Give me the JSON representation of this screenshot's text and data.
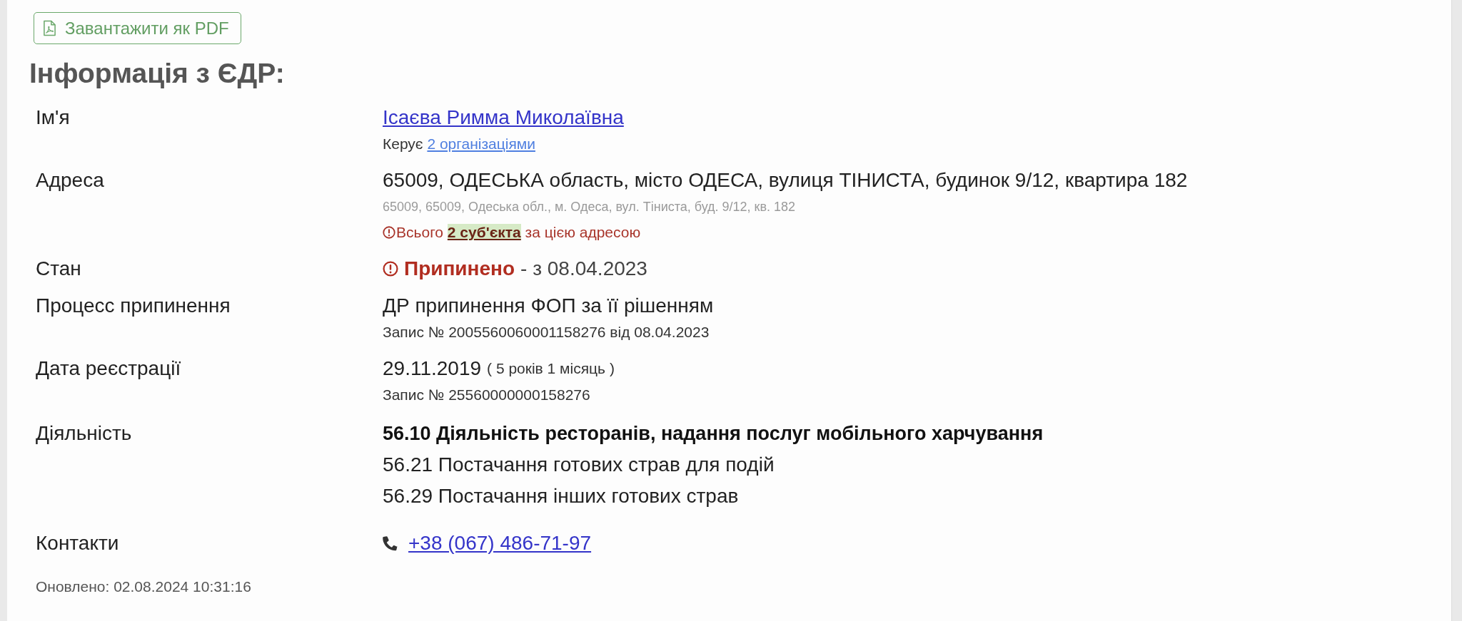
{
  "download_button": {
    "label": "Завантажити як PDF"
  },
  "title": "Інформація з ЄДР:",
  "fields": [
    {
      "kind": "name",
      "label": "Ім'я",
      "value": "Ісаєва Римма Миколаївна",
      "note": {
        "text": "Керує",
        "link": "2 організаціями"
      }
    },
    {
      "kind": "address",
      "label": "Адреса",
      "value": "65009, ОДЕСЬКА область, місто ОДЕСА, вулиця ТІНИСТА, будинок 9/12, квартира 182",
      "alt_value": "65009, 65009, Одеська обл., м. Одеса, вул. Тіниста, буд. 9/12, кв. 182",
      "warning": {
        "before": "Всього",
        "link": "2 суб'єкта",
        "after": "за цією адресою"
      }
    },
    {
      "kind": "status",
      "label": "Стан",
      "status": "Припинено",
      "since": "- з 08.04.2023"
    },
    {
      "kind": "record",
      "label": "Процесс припинення",
      "value": "ДР припинення ФОП за її рішенням",
      "note": "Запис № 2005560060001158276 від 08.04.2023"
    },
    {
      "kind": "date",
      "label": "Дата реєстрації",
      "value": "29.11.2019",
      "age": "( 5 років 1 місяць )",
      "note": "Запис № 25560000000158276"
    },
    {
      "kind": "activities",
      "label": "Діяльність",
      "items": [
        {
          "text": "56.10 Діяльність ресторанів, надання послуг мобільного харчування",
          "primary": true
        },
        {
          "text": "56.21 Постачання готових страв для подій",
          "primary": false
        },
        {
          "text": "56.29 Постачання інших готових страв",
          "primary": false
        }
      ]
    },
    {
      "kind": "contacts",
      "label": "Контакти",
      "phone": "+38 (067) 486-71-97"
    }
  ],
  "updated": "Оновлено: 02.08.2024 10:31:16"
}
